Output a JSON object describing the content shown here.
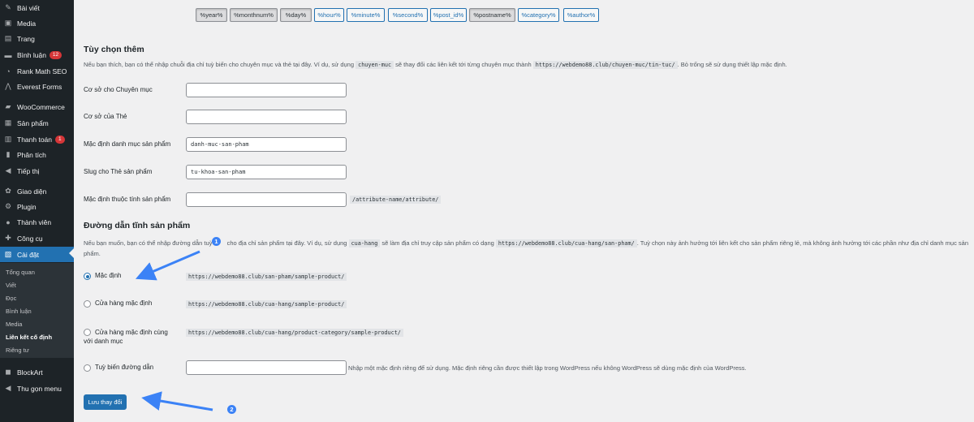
{
  "sidebar": {
    "items": [
      {
        "label": "Bài viết",
        "icon": "pin-icon",
        "glyph": "✎"
      },
      {
        "label": "Media",
        "icon": "media-icon",
        "glyph": "▣"
      },
      {
        "label": "Trang",
        "icon": "page-icon",
        "glyph": "▤"
      },
      {
        "label": "Bình luận",
        "icon": "comment-icon",
        "glyph": "▬",
        "badge": "12"
      },
      {
        "label": "Rank Math SEO",
        "icon": "rankmath-icon",
        "glyph": "◔"
      },
      {
        "label": "Everest Forms",
        "icon": "forms-icon",
        "glyph": "⋀"
      },
      {
        "label": "WooCommerce",
        "icon": "woocommerce-icon",
        "glyph": "▰"
      },
      {
        "label": "Sản phẩm",
        "icon": "product-icon",
        "glyph": "▦"
      },
      {
        "label": "Thanh toán",
        "icon": "payment-icon",
        "glyph": "▥",
        "badge": "1"
      },
      {
        "label": "Phân tích",
        "icon": "analytics-icon",
        "glyph": "▮"
      },
      {
        "label": "Tiếp thị",
        "icon": "marketing-icon",
        "glyph": "◀"
      },
      {
        "label": "Giao diện",
        "icon": "appearance-icon",
        "glyph": "✿"
      },
      {
        "label": "Plugin",
        "icon": "plugin-icon",
        "glyph": "⚙"
      },
      {
        "label": "Thành viên",
        "icon": "users-icon",
        "glyph": "●"
      },
      {
        "label": "Công cụ",
        "icon": "tools-icon",
        "glyph": "✚"
      },
      {
        "label": "Cài đặt",
        "icon": "settings-icon",
        "glyph": "▧",
        "active": true
      },
      {
        "label": "BlockArt",
        "icon": "blockart-icon",
        "glyph": "◼"
      },
      {
        "label": "Thu gọn menu",
        "icon": "collapse-icon",
        "glyph": "◀"
      }
    ],
    "submenu": [
      {
        "label": "Tổng quan"
      },
      {
        "label": "Viết"
      },
      {
        "label": "Đọc"
      },
      {
        "label": "Bình luận"
      },
      {
        "label": "Media"
      },
      {
        "label": "Liên kết cố định",
        "current": true
      },
      {
        "label": "Riêng tư"
      }
    ]
  },
  "tags": [
    {
      "label": "%year%",
      "pressed": true
    },
    {
      "label": "%monthnum%",
      "pressed": true
    },
    {
      "label": "%day%",
      "pressed": true
    },
    {
      "label": "%hour%",
      "pressed": false
    },
    {
      "label": "%minute%",
      "pressed": false
    },
    {
      "label": "%second%",
      "pressed": false
    },
    {
      "label": "%post_id%",
      "pressed": false
    },
    {
      "label": "%postname%",
      "pressed": true
    },
    {
      "label": "%category%",
      "pressed": false
    },
    {
      "label": "%author%",
      "pressed": false
    }
  ],
  "optional": {
    "title": "Tùy chọn thêm",
    "desc_before": "Nếu bạn thích, bạn có thể nhập chuỗi địa chỉ tuỳ biến cho chuyên mục và thẻ tại đây. Ví dụ, sử dụng",
    "desc_code1": "chuyen-muc",
    "desc_middle": "sẽ thay đổi các liên kết tới từng chuyên mục thành",
    "desc_code2": "https://webdemo88.club/chuyen-muc/tin-tuc/",
    "desc_after": ". Bỏ trống sẽ sử dụng thiết lập mặc định.",
    "fields": [
      {
        "label": "Cơ sở cho Chuyên mục",
        "value": "",
        "suffix": ""
      },
      {
        "label": "Cơ sở của Thẻ",
        "value": "",
        "suffix": ""
      },
      {
        "label": "Mặc định danh mục sản phẩm",
        "value": "danh-muc-san-pham",
        "suffix": ""
      },
      {
        "label": "Slug cho Thẻ sản phẩm",
        "value": "tu-khoa-san-pham",
        "suffix": ""
      },
      {
        "label": "Mặc định thuộc tính sản phẩm",
        "value": "",
        "suffix": "/attribute-name/attribute/"
      }
    ]
  },
  "product": {
    "title": "Đường dẫn tĩnh sản phẩm",
    "desc_before": "Nếu bạn muốn, bạn có thể nhập đường dẫn tuỳ",
    "desc_mid1": "cho địa chỉ sản phẩm tại đây. Ví dụ, sử dụng",
    "desc_code1": "cua-hang",
    "desc_mid2": "sẽ làm địa chỉ truy cập sản phẩm có dạng",
    "desc_code2": "https://webdemo88.club/cua-hang/san-pham/",
    "desc_after": ". Tuỳ chọn này ảnh hưởng tới liên kết cho sản phẩm riêng lẻ, mà không ảnh hưởng tới các phần như địa chỉ danh mục sản",
    "desc_line2": "phẩm.",
    "options": [
      {
        "label": "Mặc định",
        "sample": "https://webdemo88.club/san-pham/sample-product/",
        "checked": true
      },
      {
        "label": "Cửa hàng mặc định",
        "sample": "https://webdemo88.club/cua-hang/sample-product/",
        "checked": false
      },
      {
        "label": "Cửa hàng mặc định cùng với danh mục",
        "sample": "https://webdemo88.club/cua-hang/product-category/sample-product/",
        "checked": false
      },
      {
        "label": "Tuỳ biến đường dẫn",
        "sample": "",
        "checked": false,
        "note": "Nhập một mặc định riêng để sử dụng. Mặc định riêng cần được thiết lập trong WordPress nếu không WordPress sẽ dùng mặc định của WordPress."
      }
    ]
  },
  "save_label": "Lưu thay đổi",
  "annotations": {
    "step1": "1",
    "step2": "2",
    "color": "#3b82f6"
  }
}
